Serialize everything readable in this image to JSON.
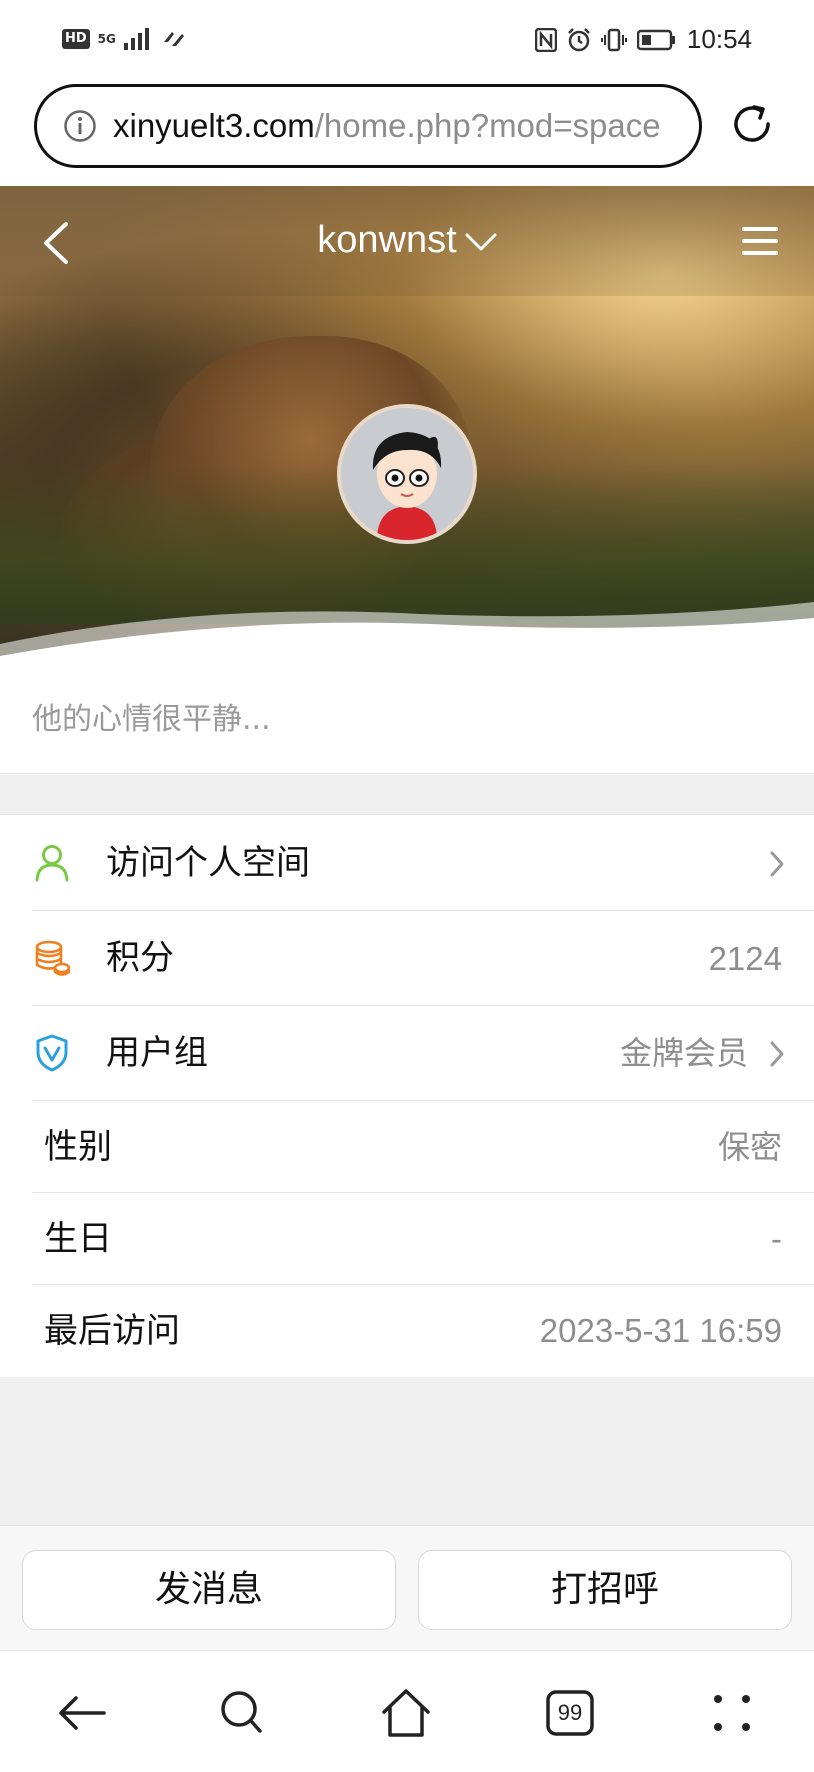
{
  "status_bar": {
    "left_badges": [
      "HD",
      "5G"
    ],
    "time": "10:54"
  },
  "browser": {
    "url_host": "xinyuelt3.com",
    "url_path": "/home.php?mod=space"
  },
  "header": {
    "username": "konwnst"
  },
  "profile": {
    "signature": "他的心情很平静..."
  },
  "info_rows": [
    {
      "label": "访问个人空间",
      "value": "",
      "icon": "user-icon",
      "icon_color": "#7ac943"
    },
    {
      "label": "积分",
      "value": "2124",
      "icon": "coins-icon",
      "icon_color": "#f07f1f"
    },
    {
      "label": "用户组",
      "value": "金牌会员",
      "icon": "shield-v-icon",
      "icon_color": "#2aa0e0"
    },
    {
      "label": "性别",
      "value": "保密"
    },
    {
      "label": "生日",
      "value": "-"
    },
    {
      "label": "最后访问",
      "value": "2023-5-31 16:59"
    }
  ],
  "actions": {
    "message_label": "发消息",
    "greet_label": "打招呼"
  },
  "bottom_nav": {
    "tabs_count": "99"
  }
}
